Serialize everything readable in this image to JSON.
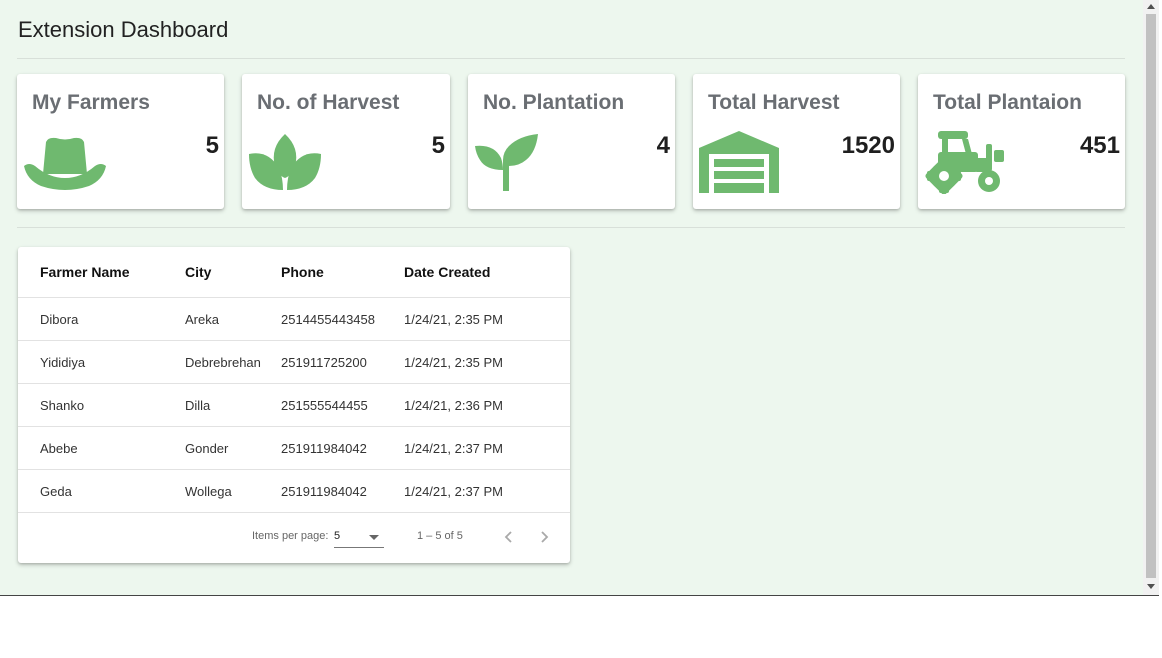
{
  "header": {
    "title": "Extension Dashboard"
  },
  "cards": [
    {
      "title": "My Farmers",
      "value": "5",
      "icon": "cowboy-hat-icon"
    },
    {
      "title": "No. of Harvest",
      "value": "5",
      "icon": "lotus-leaf-icon"
    },
    {
      "title": "No. Plantation",
      "value": "4",
      "icon": "seedling-icon"
    },
    {
      "title": "Total Harvest",
      "value": "1520",
      "icon": "warehouse-icon"
    },
    {
      "title": "Total Plantaion",
      "value": "451",
      "icon": "tractor-icon"
    }
  ],
  "table": {
    "headers": [
      "Farmer Name",
      "City",
      "Phone",
      "Date Created"
    ],
    "rows": [
      [
        "Dibora",
        "Areka",
        "2514455443458",
        "1/24/21, 2:35 PM"
      ],
      [
        "Yididiya",
        "Debrebrehan",
        "251911725200",
        "1/24/21, 2:35 PM"
      ],
      [
        "Shanko",
        "Dilla",
        "251555544455",
        "1/24/21, 2:36 PM"
      ],
      [
        "Abebe",
        "Gonder",
        "251911984042",
        "1/24/21, 2:37 PM"
      ],
      [
        "Geda",
        "Wollega",
        "251911984042",
        "1/24/21, 2:37 PM"
      ]
    ]
  },
  "paginator": {
    "items_per_page_label": "Items per page:",
    "items_per_page_value": "5",
    "range_label": "1 – 5 of 5",
    "prev_icon": "chevron-left-icon",
    "next_icon": "chevron-right-icon"
  },
  "colors": {
    "accent_green": "#6fb96f",
    "background": "#edf7ee",
    "card_title": "#6a6e73"
  }
}
